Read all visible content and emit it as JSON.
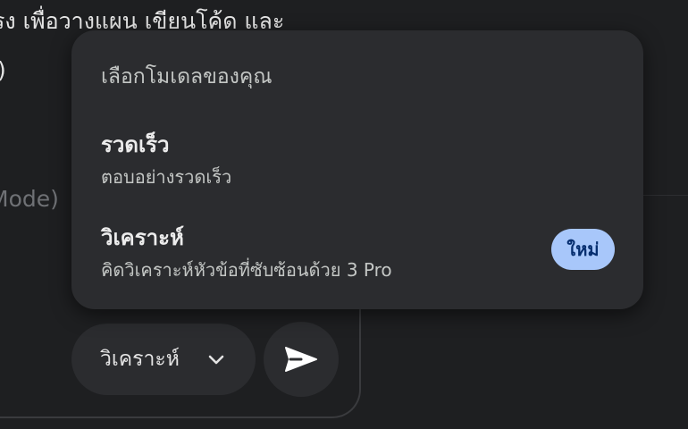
{
  "background": {
    "line1": "รง เพื่อวางแผน เขียนโค้ด และ",
    "line2": "l)",
    "faded": "Mode)"
  },
  "menu": {
    "header": "เลือกโมเดลของคุณ",
    "items": [
      {
        "title": "รวดเร็ว",
        "description": "ตอบอย่างรวดเร็ว",
        "badge": ""
      },
      {
        "title": "วิเคราะห์",
        "description": "คิดวิเคราะห์หัวข้อที่ซับซ้อนด้วย 3 Pro",
        "badge": "ใหม่"
      }
    ]
  },
  "composer": {
    "model_selector_label": "วิเคราะห์",
    "chevron_icon": "chevron-down-icon",
    "send_icon": "send-icon"
  },
  "colors": {
    "background": "#1e1f21",
    "surface": "#2b2c2f",
    "badge_bg": "#a8c7fa",
    "badge_text": "#062e6f"
  }
}
